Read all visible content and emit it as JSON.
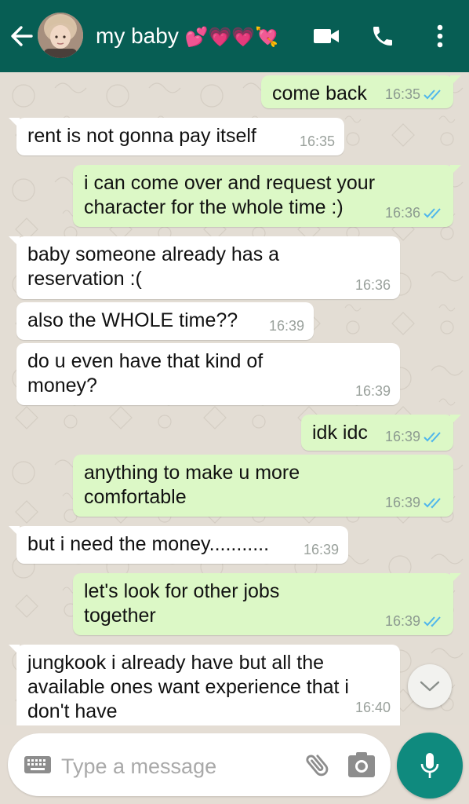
{
  "header": {
    "title": "my baby",
    "emojis": "💕💗💗💘",
    "avatar": "avatar-photo",
    "icons": [
      "back-arrow-icon",
      "video-call-icon",
      "voice-call-icon",
      "more-options-icon"
    ]
  },
  "messages": [
    {
      "dir": "out",
      "text": "come back",
      "time": "16:35",
      "read": true
    },
    {
      "dir": "in",
      "text": "rent is not gonna pay itself",
      "time": "16:35"
    },
    {
      "dir": "out",
      "text": "i can come over and request your\ncharacter for the whole time :)",
      "time": "16:36",
      "read": true
    },
    {
      "dir": "in",
      "text": "baby someone already has a\nreservation :(",
      "time": "16:36"
    },
    {
      "dir": "in",
      "text": "also the WHOLE time??",
      "time": "16:39"
    },
    {
      "dir": "in",
      "text": "do u even have that kind of\nmoney?",
      "time": "16:39"
    },
    {
      "dir": "out",
      "text": "idk idc",
      "time": "16:39",
      "read": true
    },
    {
      "dir": "out",
      "text": "anything to make u more\ncomfortable",
      "time": "16:39",
      "read": true
    },
    {
      "dir": "in",
      "text": "but i need the money...........",
      "time": "16:39"
    },
    {
      "dir": "out",
      "text": "let's look for other jobs\ntogether",
      "time": "16:39",
      "read": true
    },
    {
      "dir": "in",
      "text": "jungkook i already have but all the\navailable ones want experience that i\ndon't have",
      "time": "16:40"
    }
  ],
  "composer": {
    "placeholder": "Type a message",
    "icons": [
      "keyboard-icon",
      "attach-icon",
      "camera-icon",
      "mic-icon"
    ]
  },
  "colors": {
    "header": "#075e54",
    "outgoing_bubble": "#dcf8c6",
    "incoming_bubble": "#ffffff",
    "read_ticks": "#4fb6ec",
    "mic_button": "#0f8a7e"
  }
}
